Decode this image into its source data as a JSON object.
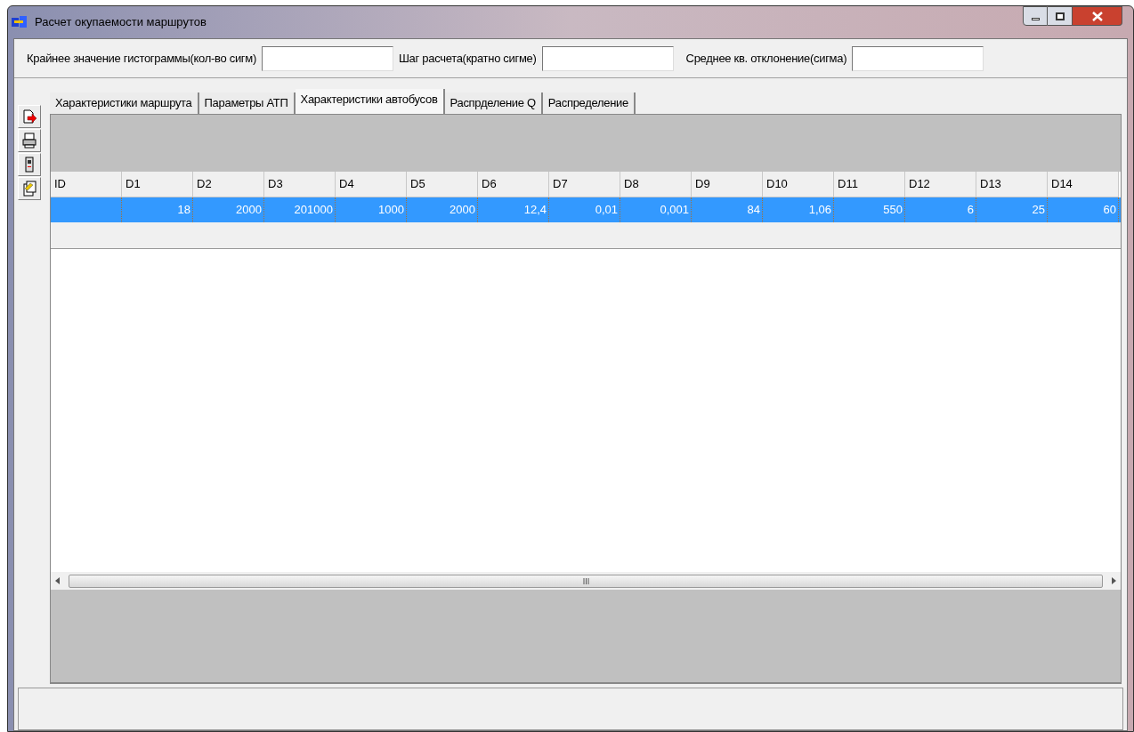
{
  "window": {
    "title": "Расчет окупаемости маршрутов"
  },
  "fields": [
    {
      "label": "Крайнее значение гистограммы(кол-во сигм)"
    },
    {
      "label": "Шаг расчета(кратно сигме)"
    },
    {
      "label": "Среднее кв. отклонение(сигма)"
    }
  ],
  "tabs": [
    {
      "label": "Характеристики маршрута",
      "selected": false
    },
    {
      "label": "Параметры АТП",
      "selected": false
    },
    {
      "label": "Характеристики автобусов",
      "selected": true
    },
    {
      "label": "Распрделение Q",
      "selected": false
    },
    {
      "label": "Распределение",
      "selected": false
    }
  ],
  "table": {
    "columns": [
      "ID",
      "D1",
      "D2",
      "D3",
      "D4",
      "D5",
      "D6",
      "D7",
      "D8",
      "D9",
      "D10",
      "D11",
      "D12",
      "D13",
      "D14"
    ],
    "rows": [
      {
        "selected": true,
        "cells": [
          "",
          "18",
          "2000",
          "201000",
          "1000",
          "2000",
          "12,4",
          "0,01",
          "0,001",
          "84",
          "1,06",
          "550",
          "6",
          "25",
          "60"
        ]
      }
    ]
  }
}
